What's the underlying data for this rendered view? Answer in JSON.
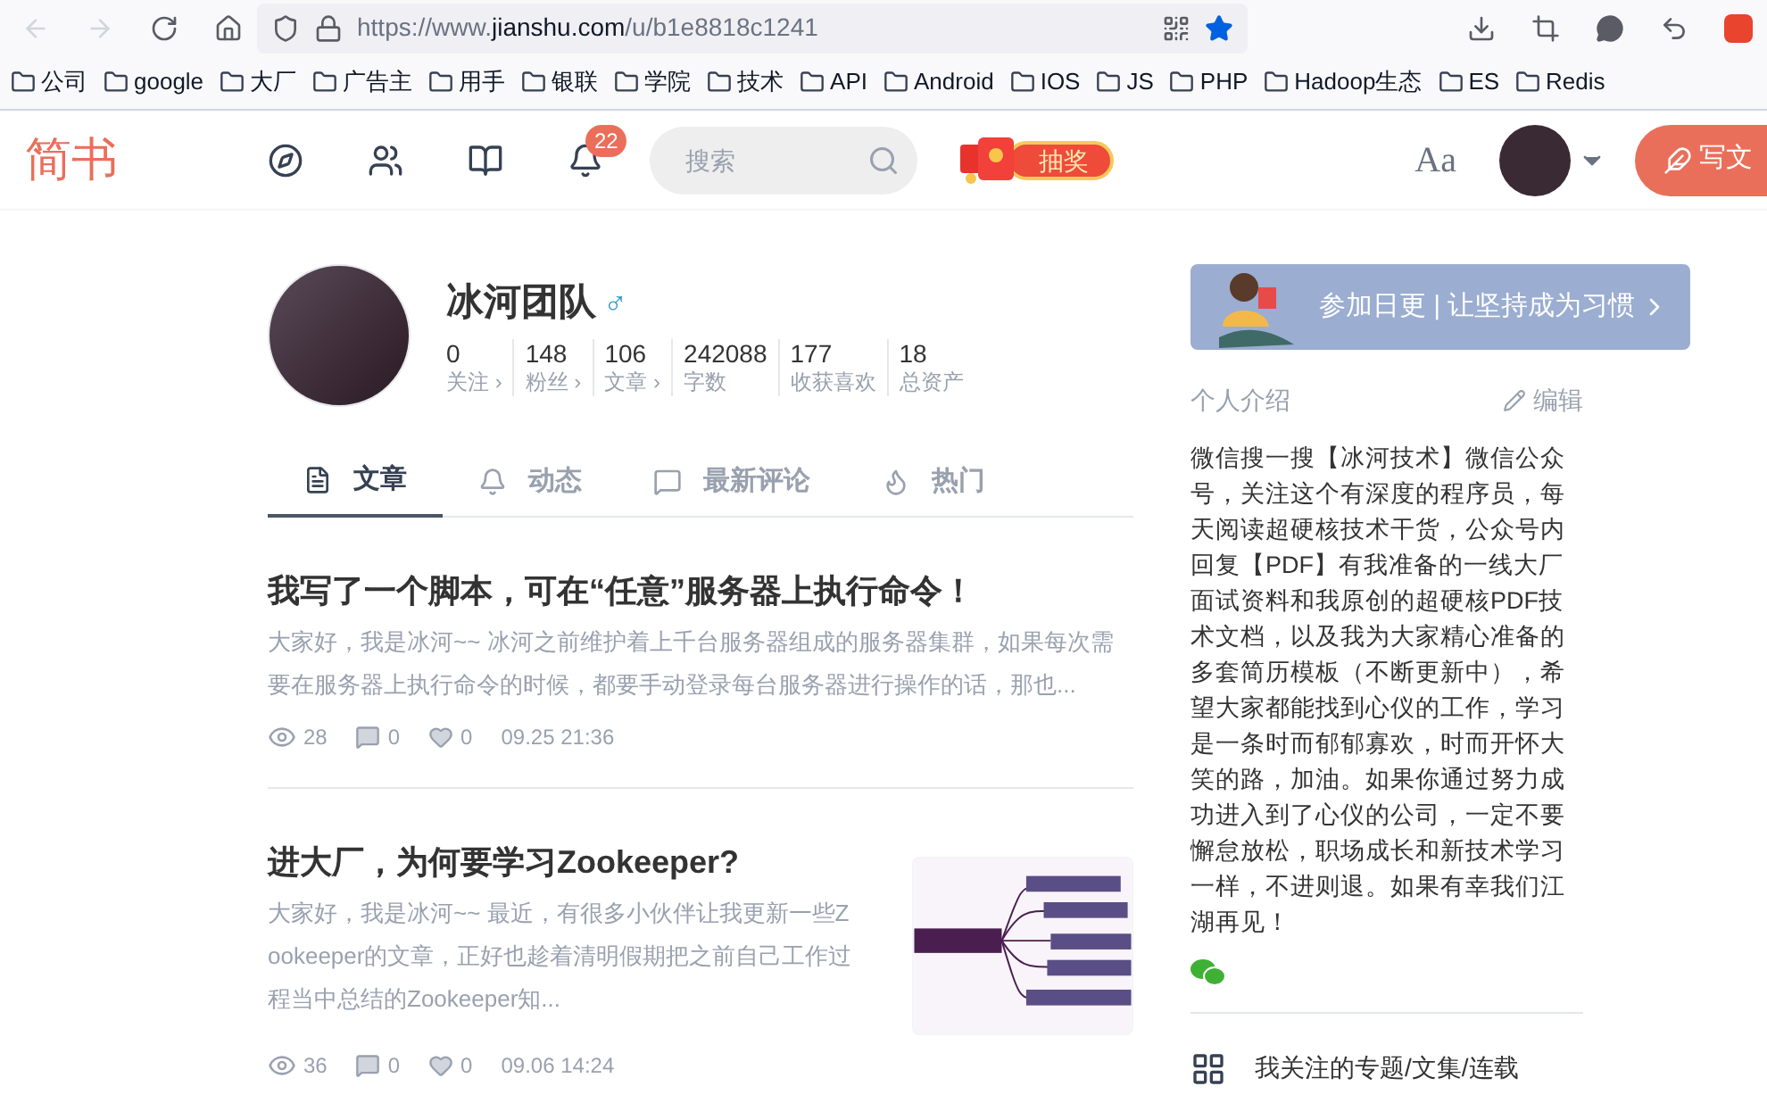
{
  "browser": {
    "url_prefix": "https://www.",
    "url_domain": "jianshu.com",
    "url_path": "/u/b1e8818c1241",
    "bookmarked": true,
    "bookmarks": [
      "公司",
      "google",
      "大厂",
      "广告主",
      "用手",
      "银联",
      "学院",
      "技术",
      "API",
      "Android",
      "IOS",
      "JS",
      "PHP",
      "Hadoop生态",
      "ES",
      "Redis"
    ]
  },
  "header": {
    "logo": "简书",
    "notification_count": "22",
    "search": {
      "placeholder": "搜索"
    },
    "lottery": "抽奖",
    "font_toggle": "Aa",
    "write_button": "写文"
  },
  "profile": {
    "name": "冰河团队",
    "gender": "♂",
    "stats": [
      {
        "value": "0",
        "label": "关注",
        "arrow": "›"
      },
      {
        "value": "148",
        "label": "粉丝",
        "arrow": "›"
      },
      {
        "value": "106",
        "label": "文章",
        "arrow": "›"
      },
      {
        "value": "242088",
        "label": "字数"
      },
      {
        "value": "177",
        "label": "收获喜欢"
      },
      {
        "value": "18",
        "label": "总资产"
      }
    ]
  },
  "tabs": [
    {
      "label": "文章",
      "kind": "doc",
      "selected": true
    },
    {
      "label": "动态",
      "kind": "bell",
      "selected": false
    },
    {
      "label": "最新评论",
      "kind": "chat",
      "selected": false
    },
    {
      "label": "热门",
      "kind": "fire",
      "selected": false
    }
  ],
  "articles": [
    {
      "title": "我写了一个脚本，可在“任意”服务器上执行命令！",
      "summary": "大家好，我是冰河~~ 冰河之前维护着上千台服务器组成的服务器集群，如果每次需要在服务器上执行命令的时候，都要手动登录每台服务器进行操作的话，那也...",
      "views": "28",
      "comments": "0",
      "likes": "0",
      "time": "09.25 21:36",
      "thumbnail": false
    },
    {
      "title": "进大厂，为何要学习Zookeeper?",
      "summary": "大家好，我是冰河~~ 最近，有很多小伙伴让我更新一些Zookeeper的文章，正好也趁着清明假期把之前自己工作过程当中总结的Zookeeper知...",
      "views": "36",
      "comments": "0",
      "likes": "0",
      "time": "09.06 14:24",
      "thumbnail": true
    }
  ],
  "sidebar": {
    "banner": "参加日更 | 让坚持成为习惯",
    "intro_title": "个人介绍",
    "edit": "编辑",
    "intro": "微信搜一搜【冰河技术】微信公众号，关注这个有深度的程序员，每天阅读超硬核技术干货，公众号内回复【PDF】有我准备的一线大厂面试资料和我原创的超硬核PDF技术文档，以及我为大家精心准备的多套简历模板（不断更新中），希望大家都能找到心仪的工作，学习是一条时而郁郁寡欢，时而开怀大笑的路，加油。如果你通过努力成功进入到了心仪的公司，一定不要懈怠放松，职场成长和新技术学习一样，不进则退。如果有幸我们江湖再见！",
    "subscriptions": "我关注的专题/文集/连载"
  }
}
